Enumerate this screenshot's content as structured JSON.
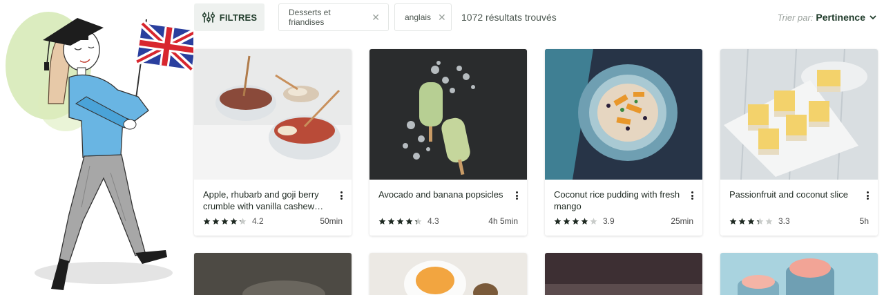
{
  "toolbar": {
    "filter_label": "FILTRES",
    "chips": [
      {
        "label": "Desserts et friandises"
      },
      {
        "label": "anglais"
      }
    ],
    "results_text": "1072 résultats trouvés",
    "sort_label": "Trier par:",
    "sort_value": "Pertinence"
  },
  "colors": {
    "accent": "#1f3b2a",
    "star_filled": "#1f2a22",
    "star_empty": "#c9ccca"
  },
  "recipes": [
    {
      "title": "Apple, rhubarb and goji berry crumble with vanilla cashew…",
      "rating": "4.2",
      "rating_value": 4.2,
      "time": "50min"
    },
    {
      "title": "Avocado and banana popsicles",
      "rating": "4.3",
      "rating_value": 4.3,
      "time": "4h 5min"
    },
    {
      "title": "Coconut rice pudding with fresh mango",
      "rating": "3.9",
      "rating_value": 3.9,
      "time": "25min"
    },
    {
      "title": "Passionfruit and coconut slice",
      "rating": "3.3",
      "rating_value": 3.3,
      "time": "5h"
    }
  ]
}
